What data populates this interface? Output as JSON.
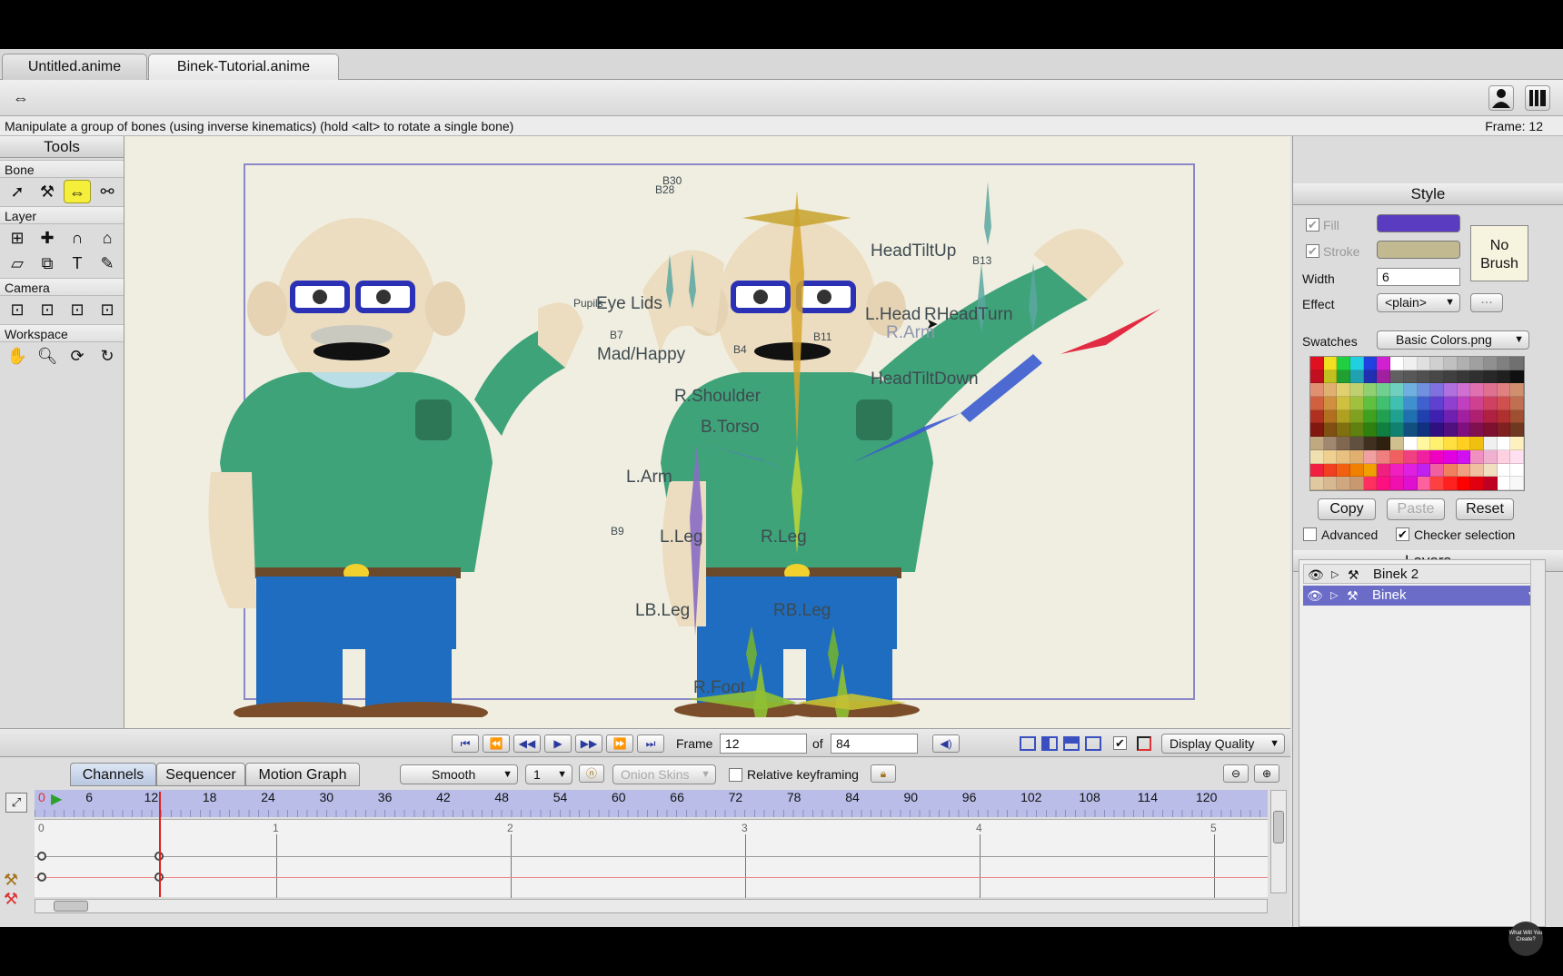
{
  "tabs": [
    "Untitled.anime",
    "Binek-Tutorial.anime"
  ],
  "status": {
    "hint": "Manipulate a group of bones (using inverse kinematics) (hold <alt> to rotate a single bone)",
    "frame_readout": "Frame: 12"
  },
  "tools": {
    "title": "Tools",
    "groups": [
      "Bone",
      "Layer",
      "Camera",
      "Workspace"
    ]
  },
  "canvas": {
    "labels": [
      "Eye Lids",
      "Pupils",
      "Mad/Happy",
      "HeadTiltUp",
      "L.Head",
      "RHeadTurn",
      "R.Arm",
      "HeadTiltDown",
      "R.Shoulder",
      "B.Torso",
      "L.Arm",
      "L.Leg",
      "R.Leg",
      "LB.Leg",
      "RB.Leg",
      "R.Foot"
    ],
    "bone_ids": [
      "B30",
      "B28",
      "B7",
      "B4",
      "B11",
      "B13",
      "B9"
    ]
  },
  "playback": {
    "frame_label": "Frame",
    "frame_value": "12",
    "of_label": "of",
    "total_frames": "84",
    "display_quality": "Display Quality"
  },
  "timeline": {
    "tabs": [
      "Channels",
      "Sequencer",
      "Motion Graph"
    ],
    "interp": "Smooth",
    "interval": "1",
    "onion": "Onion Skins",
    "relative_keyframing": "Relative keyframing",
    "ruler_ticks": [
      "0",
      "6",
      "12",
      "18",
      "24",
      "30",
      "36",
      "42",
      "48",
      "54",
      "60",
      "66",
      "72",
      "78",
      "84",
      "90",
      "96",
      "102",
      "108",
      "114",
      "120"
    ],
    "second_ticks": [
      "0",
      "1",
      "2",
      "3",
      "4",
      "5"
    ],
    "current_frame": 12
  },
  "style": {
    "title": "Style",
    "fill_label": "Fill",
    "stroke_label": "Stroke",
    "fill_color": "#5a3cc0",
    "stroke_color": "#c2b991",
    "no_brush": "No Brush",
    "width_label": "Width",
    "width_value": "6",
    "effect_label": "Effect",
    "effect_value": "<plain>",
    "effect_more": "...",
    "swatches_label": "Swatches",
    "swatches_value": "Basic Colors.png",
    "copy": "Copy",
    "paste": "Paste",
    "reset": "Reset",
    "advanced": "Advanced",
    "checker": "Checker selection"
  },
  "layers": {
    "title": "Layers",
    "items": [
      {
        "name": "Binek 2",
        "selected": false
      },
      {
        "name": "Binek",
        "selected": true
      }
    ]
  },
  "watermark": "What Will You Create?"
}
